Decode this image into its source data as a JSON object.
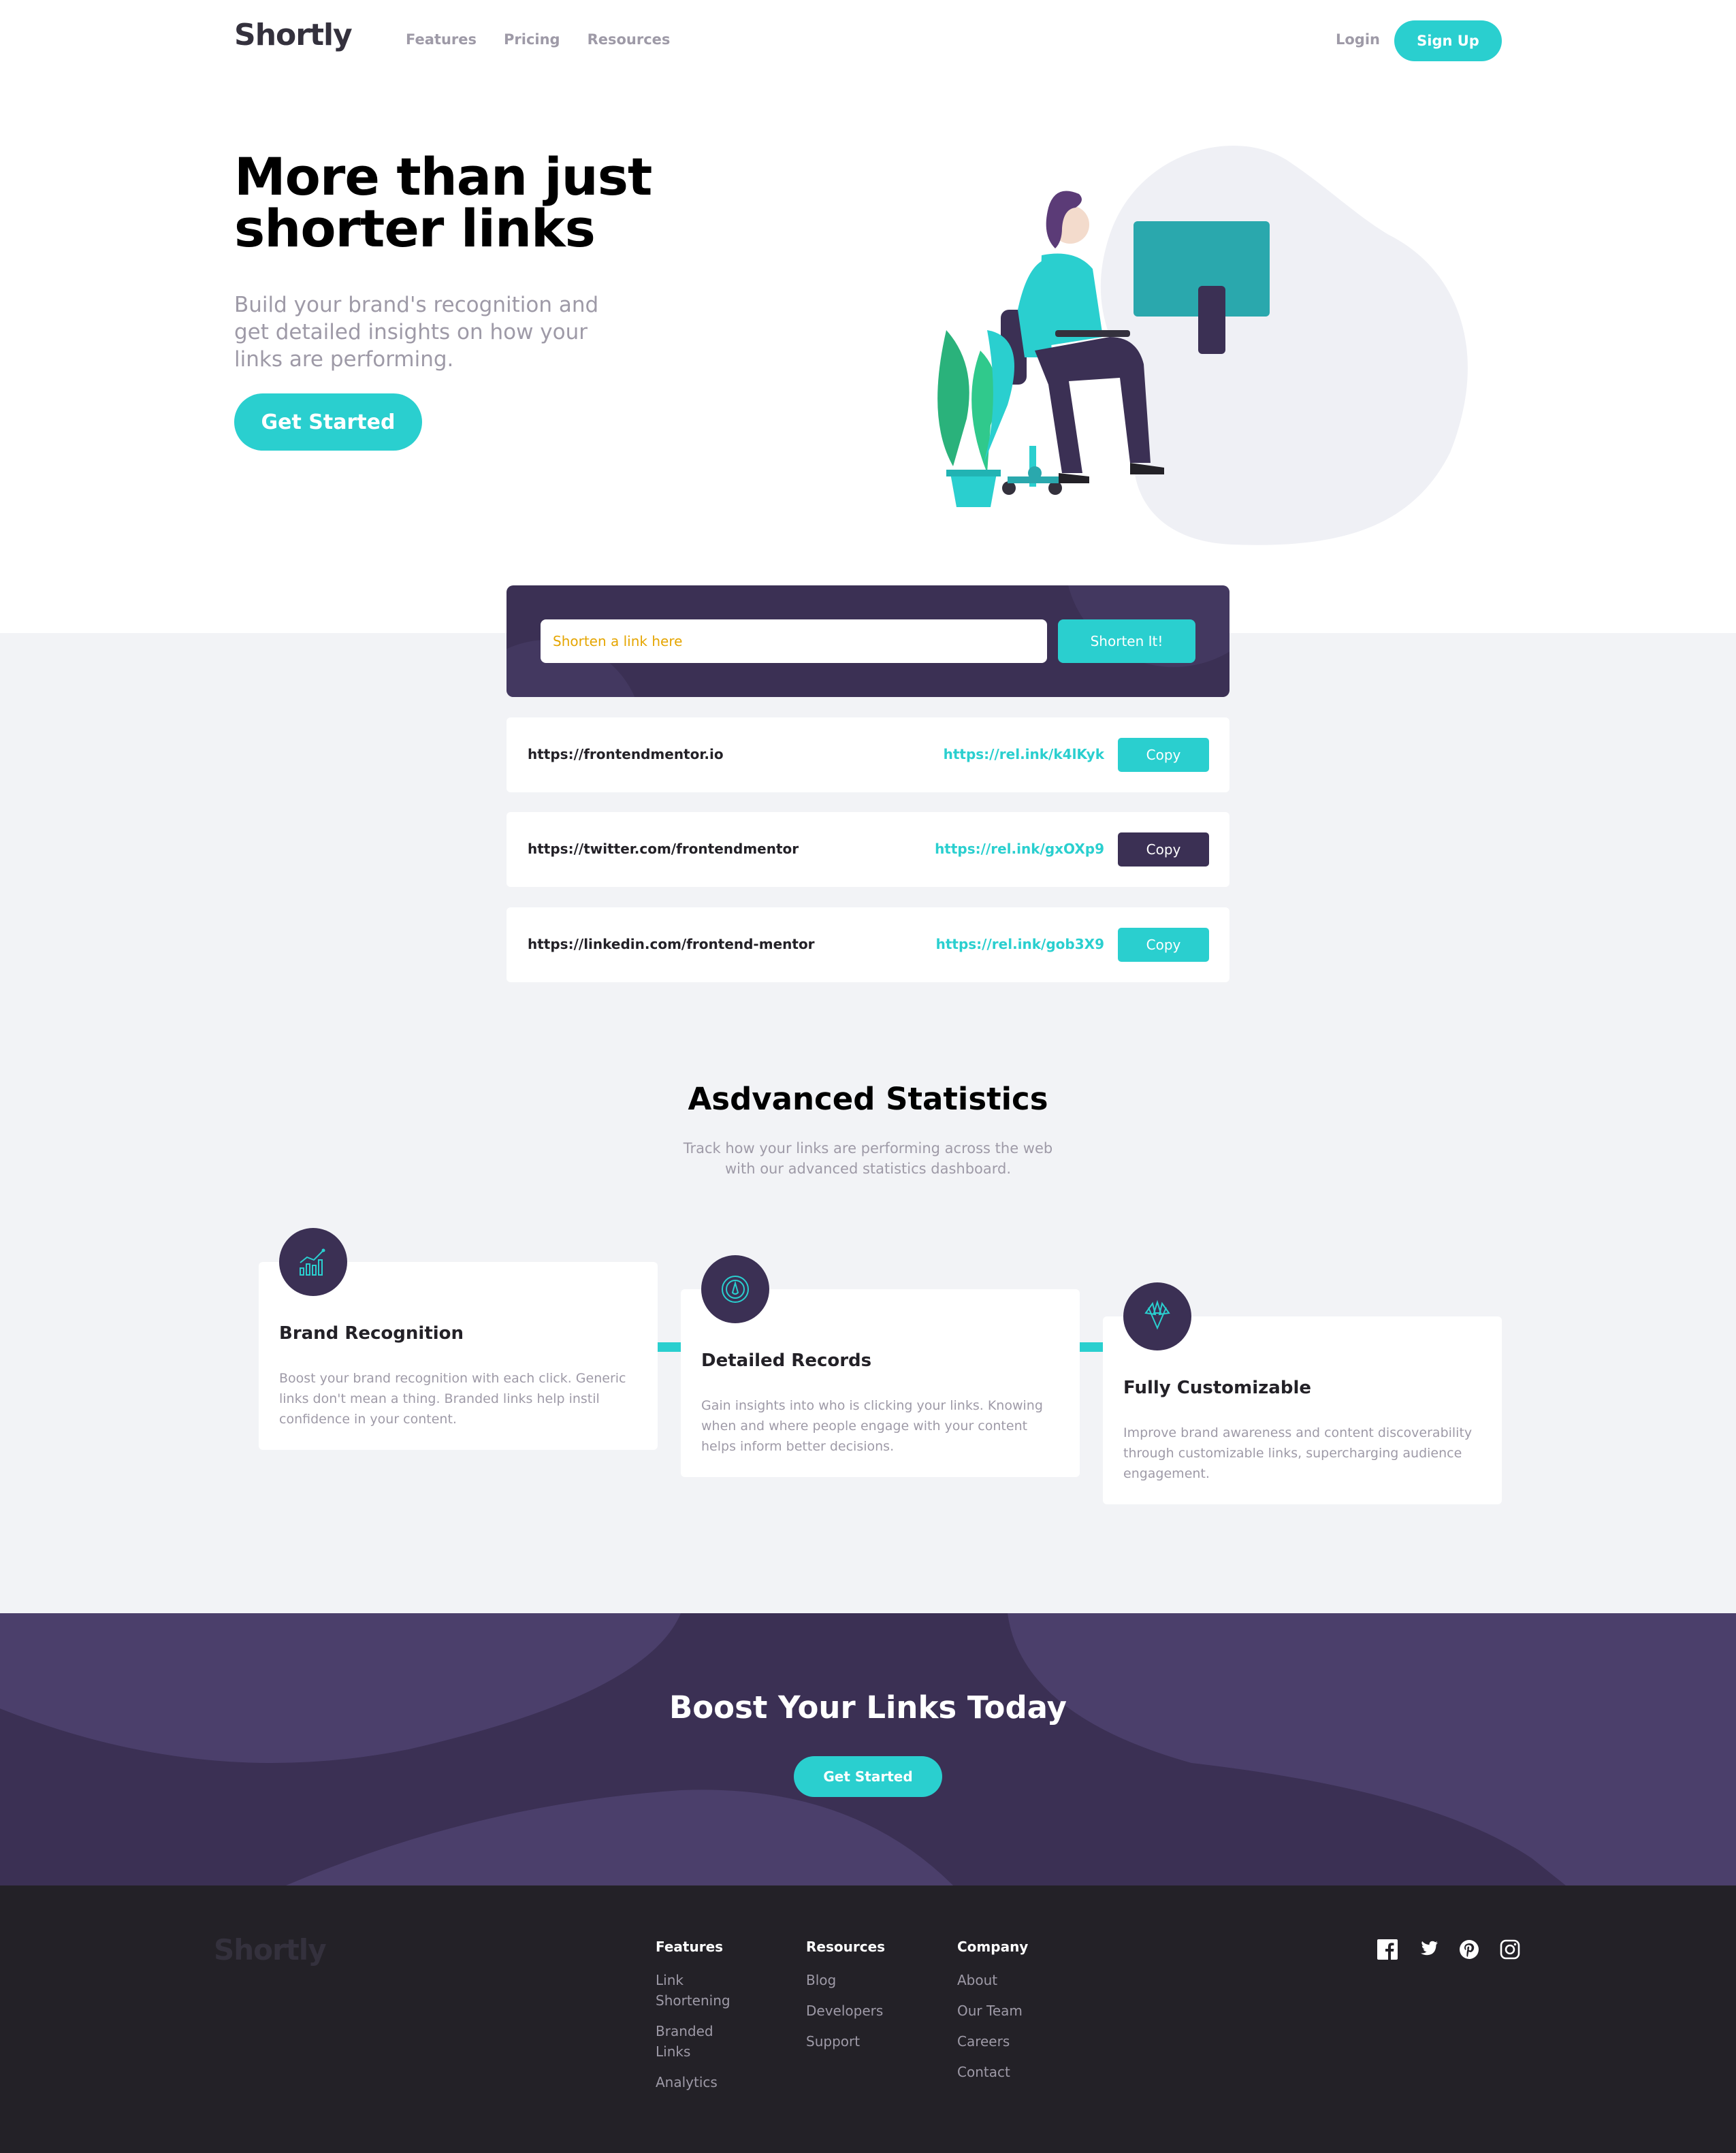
{
  "header": {
    "logo": "Shortly",
    "nav": [
      "Features",
      "Pricing",
      "Resources"
    ],
    "login": "Login",
    "signup": "Sign Up"
  },
  "hero": {
    "title": "More than just shorter links",
    "subtitle": "Build your brand's recognition and get detailed insights on how your links are performing.",
    "cta": "Get Started"
  },
  "shorten": {
    "placeholder": "Shorten a link here",
    "button": "Shorten It!"
  },
  "results": [
    {
      "original": "https://frontendmentor.io",
      "short": "https://rel.ink/k4lKyk",
      "button": "Copy",
      "copied": false
    },
    {
      "original": "https://twitter.com/frontendmentor",
      "short": "https://rel.ink/gxOXp9",
      "button": "Copy",
      "copied": true
    },
    {
      "original": "https://linkedin.com/frontend-mentor",
      "short": "https://rel.ink/gob3X9",
      "button": "Copy",
      "copied": false
    }
  ],
  "stats": {
    "title": "Asdvanced Statistics",
    "subtitle": "Track how your links are performing across the web with our advanced statistics dashboard.",
    "cards": [
      {
        "icon": "brand-recognition-icon",
        "title": "Brand Recognition",
        "text": "Boost your brand recognition with each click. Generic links don't mean a thing. Branded links help instil confidence in your content."
      },
      {
        "icon": "detailed-records-icon",
        "title": "Detailed Records",
        "text": "Gain insights into who is clicking your links. Knowing when and where people engage with your content helps inform better decisions."
      },
      {
        "icon": "fully-customizable-icon",
        "title": "Fully Customizable",
        "text": "Improve brand awareness and content discoverability through customizable links, supercharging audience engagement."
      }
    ]
  },
  "boost": {
    "title": "Boost Your Links Today",
    "cta": "Get Started"
  },
  "footer": {
    "logo": "Shortly",
    "columns": [
      {
        "title": "Features",
        "links": [
          "Link Shortening",
          "Branded Links",
          "Analytics"
        ]
      },
      {
        "title": "Resources",
        "links": [
          "Blog",
          "Developers",
          "Support"
        ]
      },
      {
        "title": "Company",
        "links": [
          "About",
          "Our Team",
          "Careers",
          "Contact"
        ]
      }
    ],
    "socials": [
      "facebook-icon",
      "twitter-icon",
      "pinterest-icon",
      "instagram-icon"
    ]
  },
  "colors": {
    "cyan": "#2acfcf",
    "dark_violet": "#3b3054",
    "grayish_violet": "#9e9aa7",
    "very_dark_violet": "#232127",
    "light_gray": "#f2f3f6"
  }
}
